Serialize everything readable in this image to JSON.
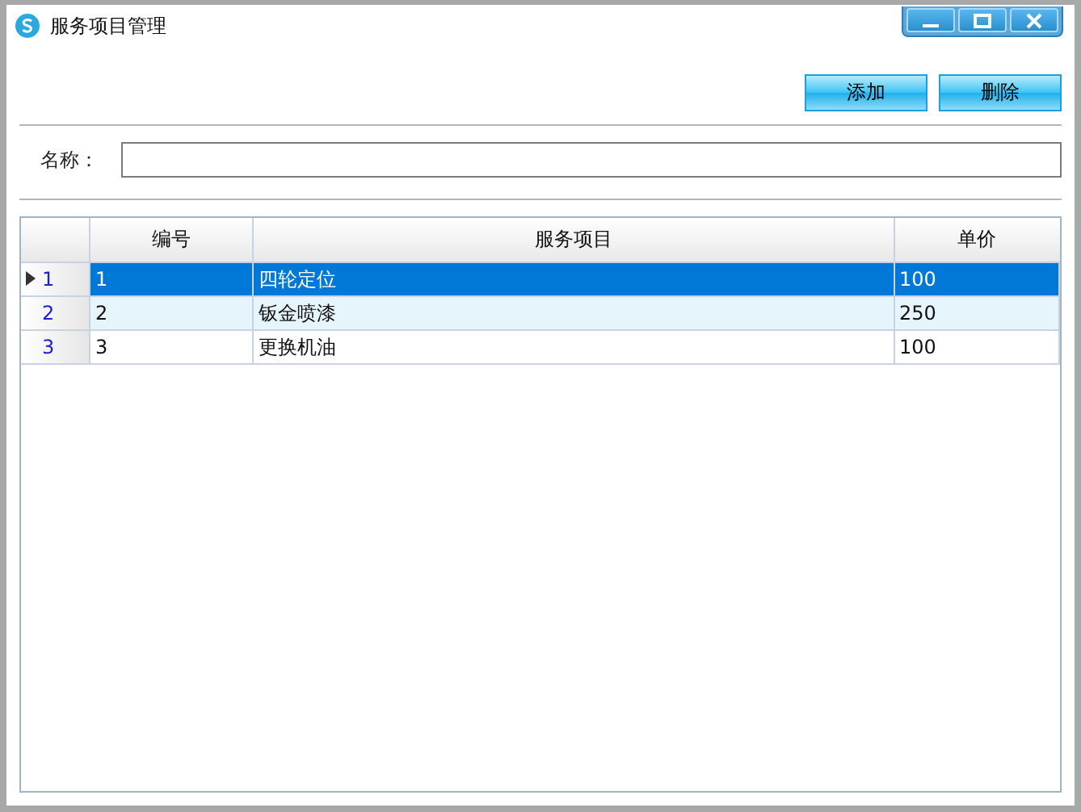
{
  "window": {
    "title": "服务项目管理"
  },
  "toolbar": {
    "buttons": [
      "添加",
      "删除"
    ]
  },
  "form": {
    "label": "名称："
  },
  "table": {
    "columns": [
      "编号",
      "服务项目",
      "单价"
    ],
    "rows": [
      {
        "row_header": "1",
        "selected": true,
        "cells": [
          "1",
          "四轮定位",
          "100"
        ]
      },
      {
        "row_header": "2",
        "selected": false,
        "cells": [
          "2",
          "钣金喷漆",
          "250"
        ]
      },
      {
        "row_header": "3",
        "selected": false,
        "cells": [
          "3",
          "更换机油",
          "100"
        ]
      }
    ]
  }
}
